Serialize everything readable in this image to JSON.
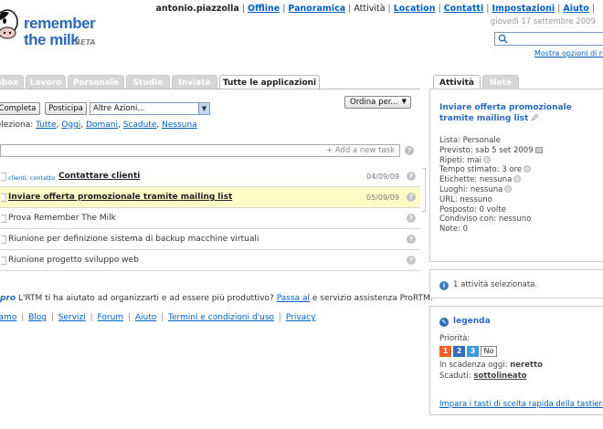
{
  "logo": {
    "line1": "remember",
    "line2": "the milk",
    "beta": "BETA"
  },
  "topnav": {
    "user": "antonio.piazzolla",
    "items": [
      "Offline",
      "Panoramica",
      "Attività",
      "Location",
      "Contatti",
      "Impostazioni",
      "Aiuto"
    ],
    "date": "giovedì 17 settembre 2009"
  },
  "search": {
    "value": "",
    "options_link": "Mostra opzioni di ricerca"
  },
  "tabs": [
    "Inbox",
    "Lavoro",
    "Personale",
    "Studio",
    "Inviate",
    "Tutte le applicazioni"
  ],
  "toolbar": {
    "complete": "Completa",
    "postpone": "Posticipa",
    "more_actions": "Altre Azioni...",
    "sort": "Ordina per..."
  },
  "selection": {
    "label": "Seleziona:",
    "options": [
      "Tutte",
      "Oggi",
      "Domani",
      "Scadute",
      "Nessuna"
    ]
  },
  "addtask": {
    "placeholder": "+ Add a new task"
  },
  "tasks": [
    {
      "tags": "clienti, contatto",
      "name": "Contattare clienti",
      "date": "04/09/09",
      "bold": true,
      "highlight": false
    },
    {
      "tags": "",
      "name": "Inviare offerta promozionale tramite mailing list",
      "date": "05/09/09",
      "bold": true,
      "highlight": true
    },
    {
      "tags": "",
      "name": "Prova Remember The Milk",
      "date": "",
      "bold": false,
      "highlight": false
    },
    {
      "tags": "",
      "name": "Riunione per definizione sistema di backup macchine virtuali",
      "date": "",
      "bold": false,
      "highlight": false
    },
    {
      "tags": "",
      "name": "Riunione progetto sviluppo web",
      "date": "",
      "bold": false,
      "highlight": false
    }
  ],
  "promo": {
    "pro": "pro",
    "text": "L'RTM ti ha aiutato ad organizzarti e ad essere più produttivo?",
    "link": "Passa al",
    "text2": "e servizio assistenza ProRTM."
  },
  "footer": [
    "Chi siamo",
    "Blog",
    "Servizi",
    "Forum",
    "Aiuto",
    "Termini e condizioni d'uso",
    "Privacy"
  ],
  "right_tabs": [
    "Attività",
    "Note"
  ],
  "detail": {
    "title": "Inviare offerta promozionale tramite mailing list",
    "lines": [
      "Lista: Personale",
      "Previsto: sab 5 set 2009",
      "Ripeti: mai",
      "Tempo stimato: 3 ore",
      "Etichette: nessuna",
      "Luoghi: nessuna",
      "URL: nessuno",
      "Posposto: 0 volte",
      "Condiviso con: nessuno",
      "Note: 0"
    ]
  },
  "selected": {
    "text": "1 attività selezionata."
  },
  "legend": {
    "title": "legenda",
    "priority_label": "Priorità:",
    "priorities": [
      "1",
      "2",
      "3",
      "No"
    ],
    "priority_colors": [
      "#e8622a",
      "#2f6bbf",
      "#3d9be0"
    ],
    "due_today": "In scadenza oggi:",
    "due_today_val": "neretto",
    "overdue": "Scaduti:",
    "overdue_val": "sottolineato",
    "shortcuts_link": "Impara i tasti di scelta rapida della tastiera"
  }
}
